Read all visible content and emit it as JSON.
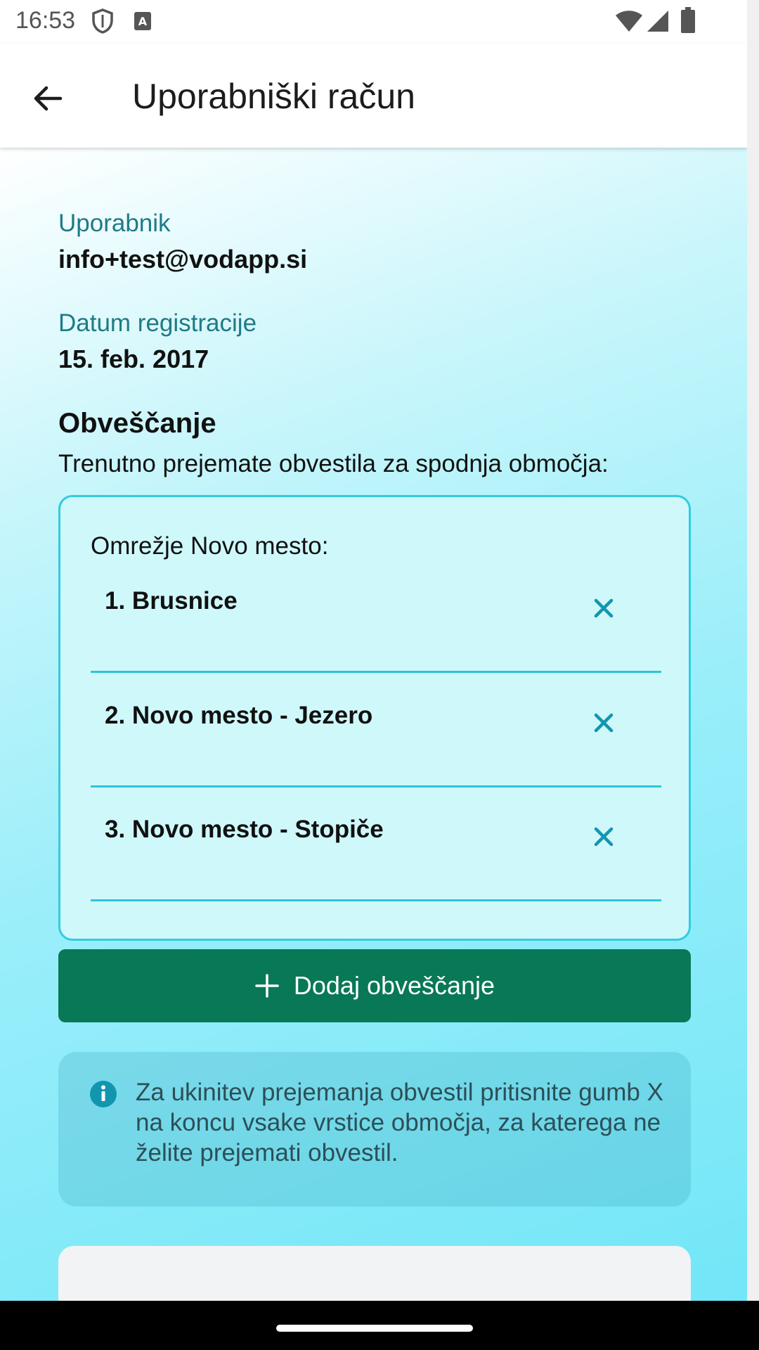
{
  "status_bar": {
    "time": "16:53",
    "icons": [
      "shield-icon",
      "text-a-icon",
      "wifi-icon",
      "signal-icon",
      "battery-icon"
    ]
  },
  "app_bar": {
    "title": "Uporabniški račun",
    "back_icon": "arrow-left-icon"
  },
  "account": {
    "user_label": "Uporabnik",
    "user_value": "info+test@vodapp.si",
    "date_label": "Datum registracije",
    "date_value": "15. feb. 2017"
  },
  "notifications": {
    "title": "Obveščanje",
    "description": "Trenutno prejemate obvestila za spodnja območja:",
    "network": "Omrežje Novo mesto:",
    "areas": [
      {
        "label": "1. Brusnice"
      },
      {
        "label": "2. Novo mesto - Jezero"
      },
      {
        "label": "3. Novo mesto - Stopiče"
      }
    ],
    "add_button": "Dodaj obveščanje"
  },
  "info": {
    "text": "Za ukinitev prejemanja obvestil pritisnite gumb X na koncu vsake vrstice območja, za katerega ne želite prejemati obvestil."
  },
  "colors": {
    "accent": "#087856",
    "border": "#33cbe0",
    "remove_x": "#1296b0",
    "label": "#1f7a86"
  }
}
